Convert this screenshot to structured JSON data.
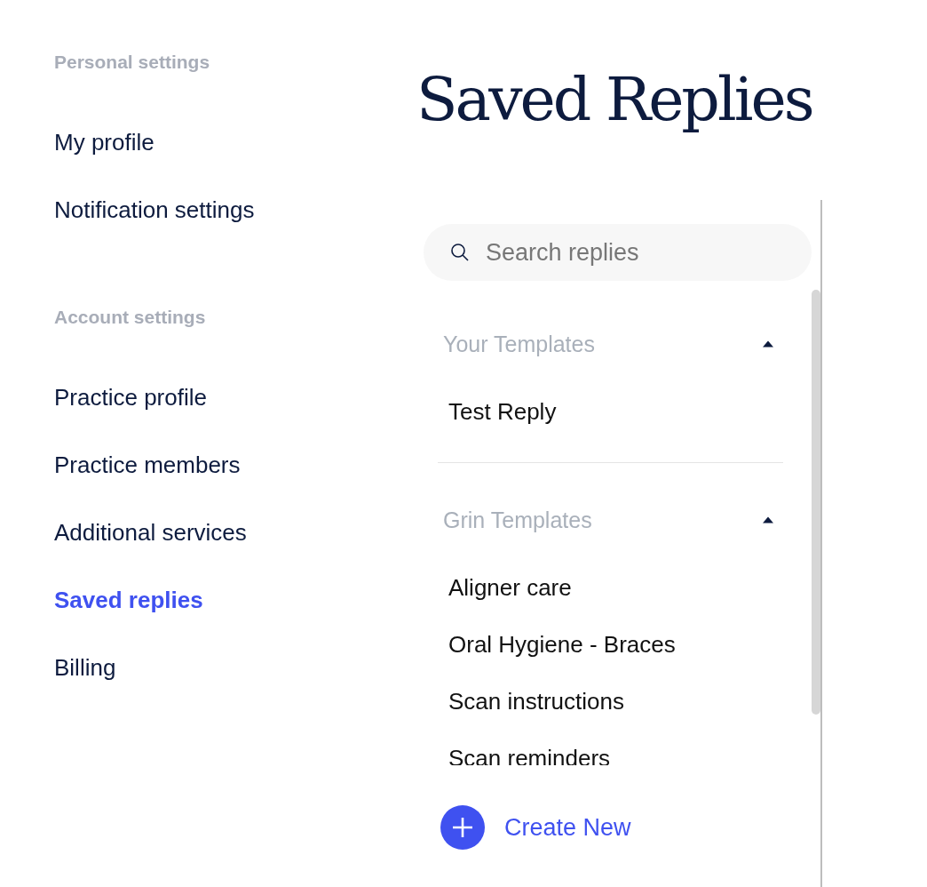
{
  "sidebar": {
    "sections": [
      {
        "heading": "Personal settings",
        "items": [
          {
            "label": "My profile",
            "selected": false
          },
          {
            "label": "Notification settings",
            "selected": false
          }
        ]
      },
      {
        "heading": "Account settings",
        "items": [
          {
            "label": "Practice profile",
            "selected": false
          },
          {
            "label": "Practice members",
            "selected": false
          },
          {
            "label": "Additional services",
            "selected": false
          },
          {
            "label": "Saved replies",
            "selected": true
          },
          {
            "label": "Billing",
            "selected": false
          }
        ]
      }
    ]
  },
  "page": {
    "title": "Saved Replies",
    "search": {
      "placeholder": "Search replies"
    },
    "groups": [
      {
        "title": "Your Templates",
        "expanded": true,
        "items": [
          "Test Reply"
        ]
      },
      {
        "title": "Grin Templates",
        "expanded": true,
        "items": [
          "Aligner care",
          "Oral Hygiene - Braces",
          "Scan instructions",
          "Scan reminders"
        ]
      }
    ],
    "create_button": {
      "label": "Create New"
    }
  }
}
